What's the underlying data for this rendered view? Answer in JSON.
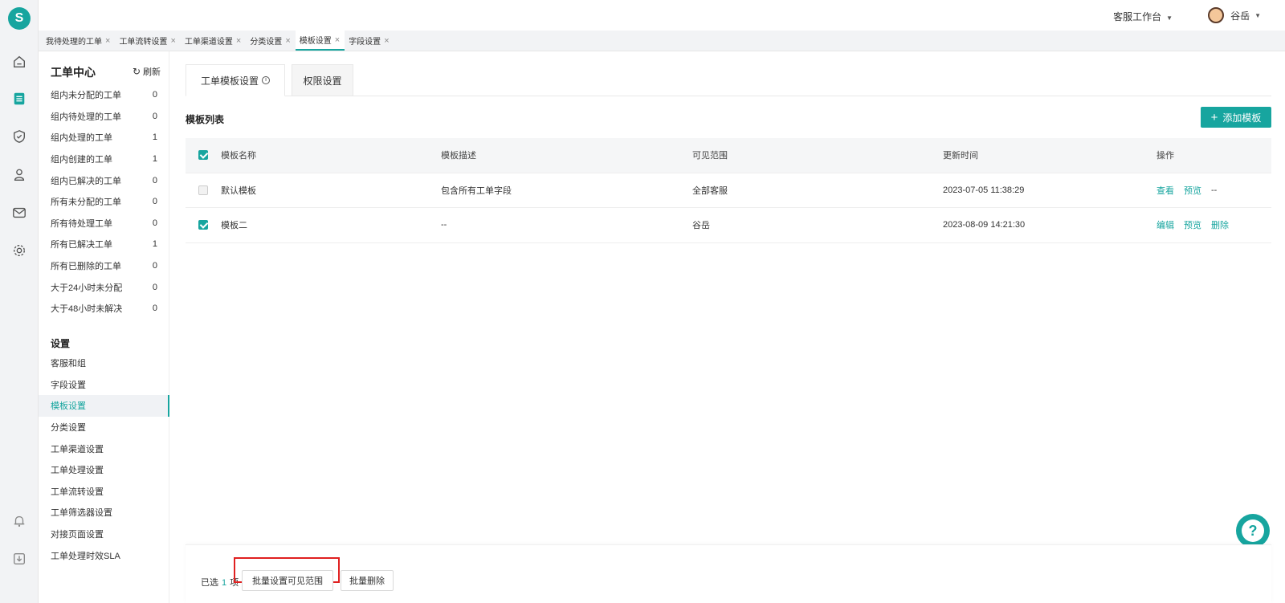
{
  "brand": {
    "logo_letter": "S",
    "accent": "#17a59f"
  },
  "rail": {
    "icons": [
      "home-icon",
      "ticket-icon",
      "shield-icon",
      "user-icon",
      "mail-icon",
      "gear-icon",
      "bell-icon",
      "download-icon"
    ]
  },
  "topbar": {
    "workspace": "客服工作台",
    "user_name": "谷岳"
  },
  "page_tabs": [
    {
      "label": "我待处理的工单",
      "close": "×"
    },
    {
      "label": "工单流转设置",
      "close": "×"
    },
    {
      "label": "工单渠道设置",
      "close": "×"
    },
    {
      "label": "分类设置",
      "close": "×"
    },
    {
      "label": "模板设置",
      "close": "×"
    },
    {
      "label": "字段设置",
      "close": "×"
    }
  ],
  "sidebar": {
    "title": "工单中心",
    "refresh": "刷新",
    "counts": [
      {
        "label": "组内未分配的工单",
        "count": "0"
      },
      {
        "label": "组内待处理的工单",
        "count": "0"
      },
      {
        "label": "组内处理的工单",
        "count": "1"
      },
      {
        "label": "组内创建的工单",
        "count": "1"
      },
      {
        "label": "组内已解决的工单",
        "count": "0"
      },
      {
        "label": "所有未分配的工单",
        "count": "0"
      },
      {
        "label": "所有待处理工单",
        "count": "0"
      },
      {
        "label": "所有已解决工单",
        "count": "1"
      },
      {
        "label": "所有已删除的工单",
        "count": "0"
      },
      {
        "label": "大于24小时未分配",
        "count": "0"
      },
      {
        "label": "大于48小时未解决",
        "count": "0"
      }
    ],
    "settings_title": "设置",
    "settings": [
      "客服和组",
      "字段设置",
      "模板设置",
      "分类设置",
      "工单渠道设置",
      "工单处理设置",
      "工单流转设置",
      "工单筛选器设置",
      "对接页面设置",
      "工单处理时效SLA"
    ]
  },
  "content_tabs": {
    "tab1": "工单模板设置",
    "info": "i",
    "tab2": "权限设置"
  },
  "list": {
    "title": "模板列表",
    "add_button": "添加模板",
    "add_plus": "+"
  },
  "table": {
    "headers": {
      "name": "模板名称",
      "desc": "模板描述",
      "scope": "可见范围",
      "time": "更新时间",
      "ops": "操作"
    },
    "rows": [
      {
        "name": "默认模板",
        "desc": "包含所有工单字段",
        "scope": "全部客服",
        "time": "2023-07-05 11:38:29",
        "op1": "查看",
        "op2": "预览",
        "op3": "--",
        "checked": false
      },
      {
        "name": "模板二",
        "desc": "--",
        "scope": "谷岳",
        "time": "2023-08-09 14:21:30",
        "op1": "编辑",
        "op2": "预览",
        "op3": "删除",
        "checked": true
      }
    ]
  },
  "bottom": {
    "selected_prefix": "已选",
    "selected_count": "1",
    "selected_suffix": "项",
    "batch_scope": "批量设置可见范围",
    "batch_delete": "批量删除"
  },
  "help": {
    "glyph": "?"
  }
}
